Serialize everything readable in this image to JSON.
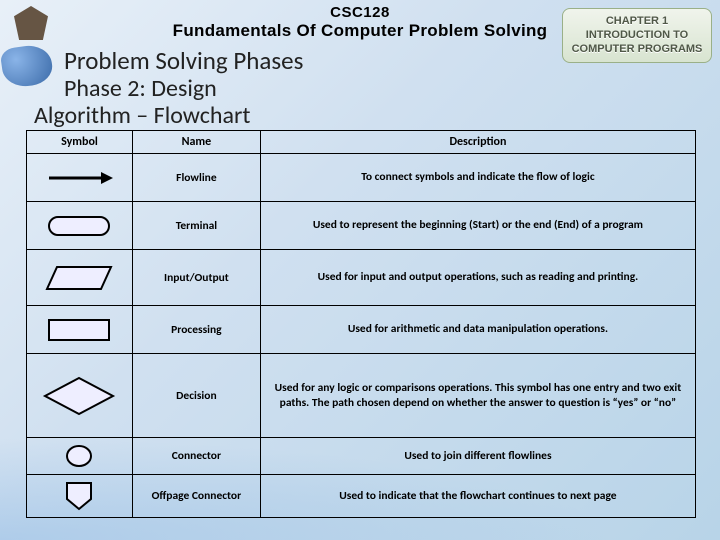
{
  "header": {
    "course_code": "CSC128",
    "course_title": "Fundamentals Of Computer Problem Solving"
  },
  "chapter_badge": {
    "line1": "CHAPTER 1",
    "line2": "INTRODUCTION TO",
    "line3": "COMPUTER PROGRAMS"
  },
  "titles": {
    "main": "Problem Solving Phases",
    "phase": "Phase 2: Design",
    "sub": "Algorithm – Flowchart"
  },
  "table": {
    "headers": {
      "symbol": "Symbol",
      "name": "Name",
      "desc": "Description"
    },
    "rows": [
      {
        "name": "Flowline",
        "desc": "To connect symbols and indicate the flow of logic"
      },
      {
        "name": "Terminal",
        "desc": "Used to represent the beginning (Start) or the end (End) of a program"
      },
      {
        "name": "Input/Output",
        "desc": "Used for input and output operations, such as reading and printing."
      },
      {
        "name": "Processing",
        "desc": "Used for arithmetic and data manipulation operations."
      },
      {
        "name": "Decision",
        "desc": "Used for any logic or comparisons operations. This symbol has one entry and two exit paths. The path chosen depend on whether the answer to question is “yes” or “no”"
      },
      {
        "name": "Connector",
        "desc": "Used to join different flowlines"
      },
      {
        "name": "Offpage Connector",
        "desc": "Used to indicate that the flowchart continues to next page"
      }
    ]
  }
}
